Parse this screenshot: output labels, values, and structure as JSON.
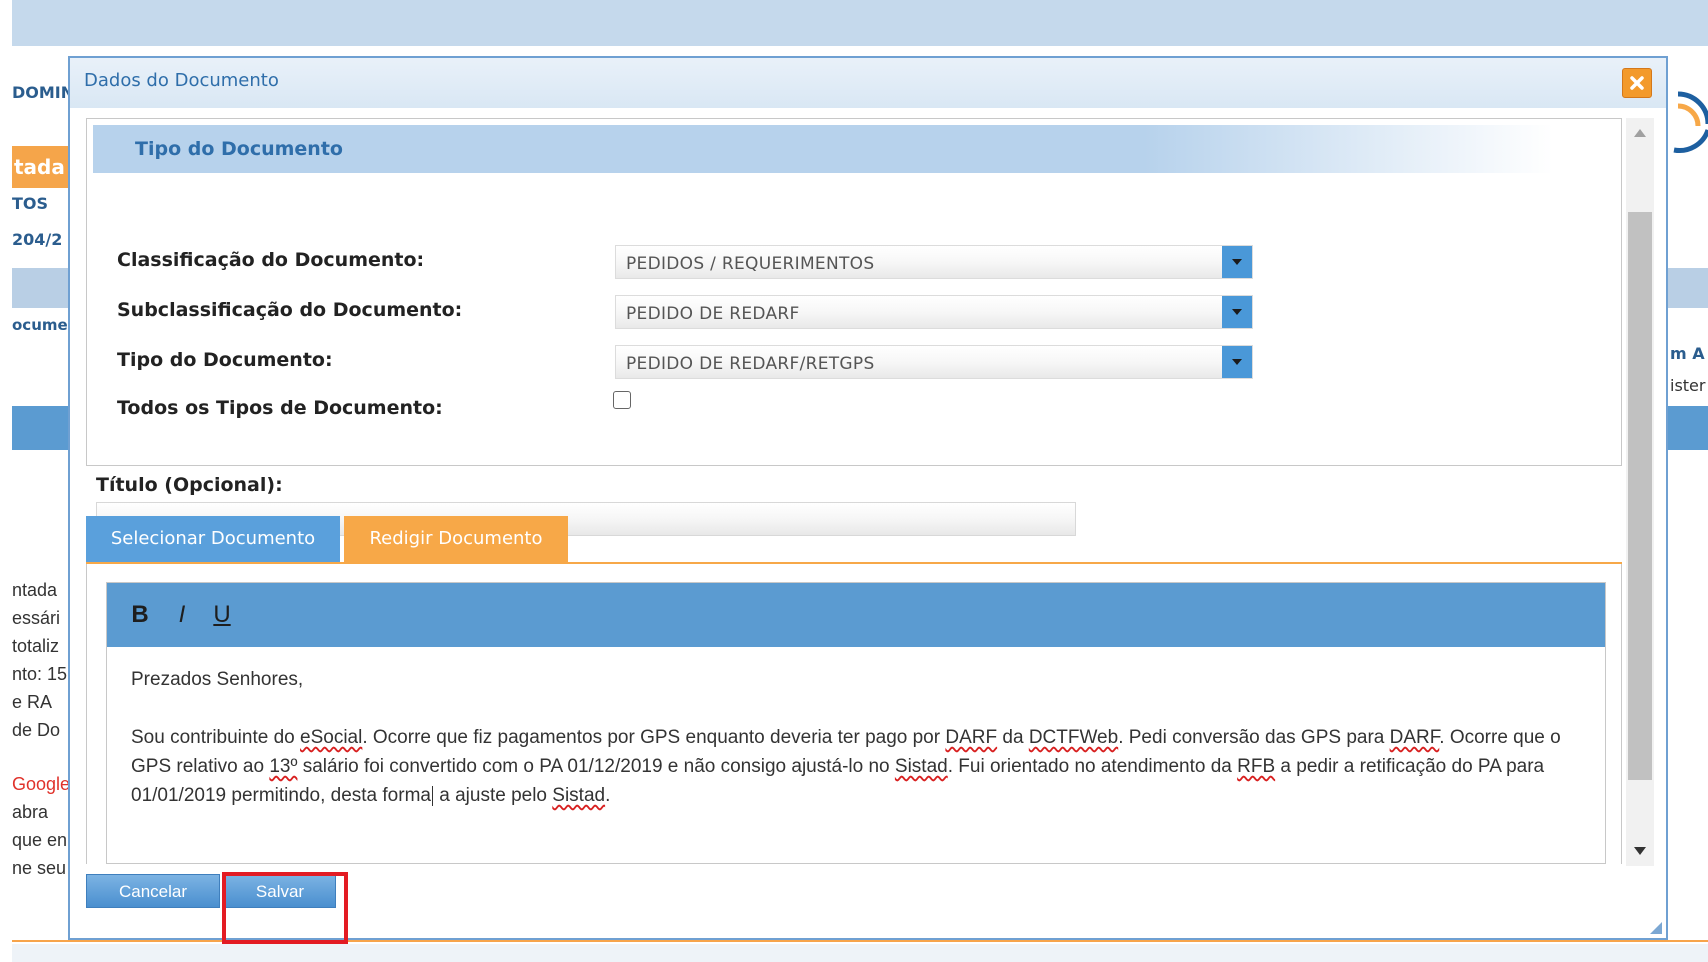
{
  "background": {
    "left_fragments": {
      "domain_text": "DOMIN",
      "orange_tab": "tada",
      "tos": "TOS",
      "date": "204/2",
      "documento": "ocume",
      "body_lines": [
        "ntada",
        "essári",
        "totaliz",
        "nto: 15",
        "e RA",
        "de Do",
        "Google",
        "abra",
        "que en",
        "ne seu"
      ]
    },
    "right_fragments": {
      "col": "m A",
      "text": "ister"
    }
  },
  "dialog": {
    "title": "Dados do Documento",
    "close_icon": "close-icon"
  },
  "tipo_section": {
    "header": "Tipo do Documento",
    "fields": [
      {
        "label": "Classificação do Documento:",
        "value": "PEDIDOS / REQUERIMENTOS"
      },
      {
        "label": "Subclassificação do Documento:",
        "value": "PEDIDO DE REDARF"
      },
      {
        "label": "Tipo do Documento:",
        "value": "PEDIDO DE REDARF/RETGPS"
      }
    ],
    "todos_label": "Todos os Tipos de Documento:",
    "todos_checked": false
  },
  "titulo": {
    "label": "Título (Opcional):",
    "value": ""
  },
  "tabs": [
    {
      "label": "Selecionar Documento",
      "active": false
    },
    {
      "label": "Redigir Documento",
      "active": true
    }
  ],
  "editor": {
    "toolbar": {
      "bold": "B",
      "italic": "I",
      "underline": "U"
    },
    "greeting": "Prezados Senhores,",
    "paragraph": {
      "t1": "Sou contribuinte do ",
      "w1": "eSocial",
      "t2": ". Ocorre que fiz pagamentos por GPS enquanto deveria ter pago por ",
      "w2": "DARF",
      "t3": " da ",
      "w3": "DCTFWeb",
      "t4": ". Pedi conversão das GPS para ",
      "w4": "DARF",
      "t5": ". Ocorre que o GPS relativo ao ",
      "w5": "13º",
      "t6": " salário foi convertido com o PA 01/12/2019 e não consigo ajustá-lo no ",
      "w6": "Sistad",
      "t7": ". Fui orientado no atendimento da ",
      "w7": "RFB",
      "t8": " a pedir a retificação do PA para 01/01/2019 permitindo, desta forma",
      "t9": " a ajuste pelo ",
      "w8": "Sistad",
      "t10": "."
    }
  },
  "buttons": {
    "cancel": "Cancelar",
    "save": "Salvar"
  },
  "colors": {
    "accent_blue": "#5b9bd1",
    "accent_orange": "#f7a848",
    "highlight_red": "#e31b23"
  }
}
